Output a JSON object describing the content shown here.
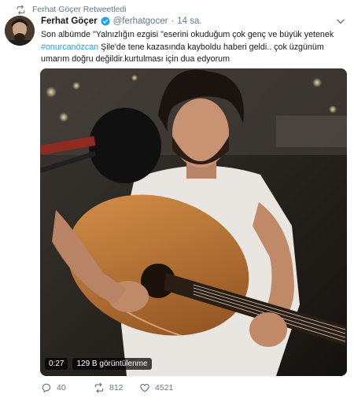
{
  "retweet": {
    "icon": "retweet-icon",
    "label": "Ferhat Göçer Retweetledi"
  },
  "author": {
    "name": "Ferhat Göçer",
    "verified_icon": "verified-badge-icon",
    "handle": "@ferhatgocer",
    "dot": "·",
    "time": "14 sa."
  },
  "menu_icon": "chevron-down-icon",
  "tweet": {
    "text_part1": "Son albümde \"Yalnızlığın ezgisi \"eserini okuduğum çok genç ve büyük yetenek",
    "hashtag": "#onurcanözcan",
    "text_part2": " Şile'de tene kazasında kayboldu haberi geldi.. çok üzgünüm umarım doğru değildir.kurtulması için dua edyorum"
  },
  "media": {
    "duration": "0:27",
    "views": "129 B görüntülenme"
  },
  "actions": {
    "reply_count": "40",
    "retweet_count": "812",
    "like_count": "4521"
  },
  "colors": {
    "accent": "#1da1f2",
    "muted": "#657786",
    "text": "#14171a"
  }
}
